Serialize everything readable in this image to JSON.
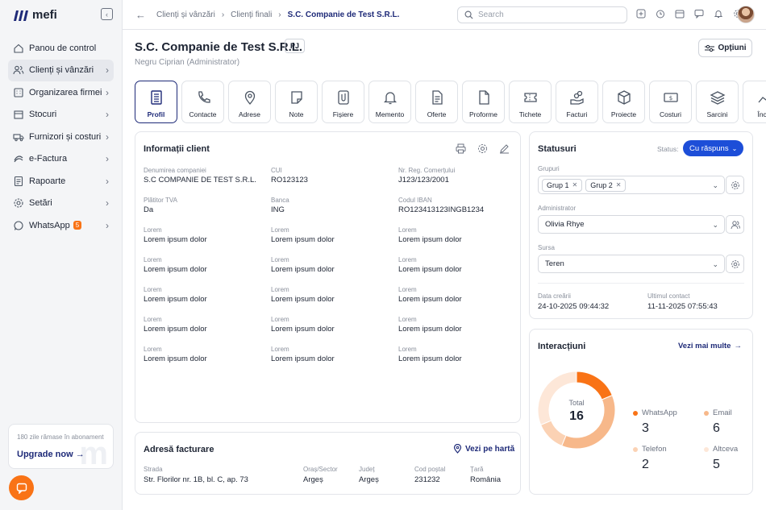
{
  "app": {
    "name": "mefi"
  },
  "sidebar": {
    "items": [
      {
        "label": "Panou de control",
        "icon": "home-icon"
      },
      {
        "label": "Clienți și vânzări",
        "icon": "users-icon",
        "active": true
      },
      {
        "label": "Organizarea firmei",
        "icon": "org-icon"
      },
      {
        "label": "Stocuri",
        "icon": "box-icon"
      },
      {
        "label": "Furnizori și costuri",
        "icon": "truck-icon"
      },
      {
        "label": "e-Factura",
        "icon": "efactura-icon"
      },
      {
        "label": "Rapoarte",
        "icon": "report-icon"
      },
      {
        "label": "Setări",
        "icon": "gear-icon"
      },
      {
        "label": "WhatsApp",
        "icon": "whatsapp-icon",
        "badge": "5"
      }
    ],
    "upgrade": {
      "subtitle": "180 zile rămase în abonament",
      "link": "Upgrade now"
    }
  },
  "topbar": {
    "breadcrumbs": [
      "Clienți și vânzări",
      "Clienți finali",
      "S.C. Companie de Test S.R.L."
    ],
    "search_placeholder": "Search"
  },
  "header": {
    "title": "S.C. Companie de Test S.R.L.",
    "type_badge": "PJ",
    "subtitle": "Negru Ciprian (Administrator)",
    "options_label": "Opțiuni"
  },
  "tabs": [
    "Profil",
    "Contacte",
    "Adrese",
    "Note",
    "Fișiere",
    "Memento",
    "Oferte",
    "Proforme",
    "Tichete",
    "Facturi",
    "Proiecte",
    "Costuri",
    "Sarcini",
    "Înca"
  ],
  "client_info": {
    "title": "Informații client",
    "rows": [
      [
        {
          "label": "Denumirea companiei",
          "value": "S.C COMPANIE DE TEST S.R.L."
        },
        {
          "label": "CUI",
          "value": "RO123123"
        },
        {
          "label": "Nr. Reg. Comerțului",
          "value": "J123/123/2001"
        }
      ],
      [
        {
          "label": "Plătitor TVA",
          "value": "Da"
        },
        {
          "label": "Banca",
          "value": "ING"
        },
        {
          "label": "Codul IBAN",
          "value": "RO123413123INGB1234"
        }
      ],
      [
        {
          "label": "Lorem",
          "value": "Lorem ipsum dolor"
        },
        {
          "label": "Lorem",
          "value": "Lorem ipsum dolor"
        },
        {
          "label": "Lorem",
          "value": "Lorem ipsum dolor"
        }
      ],
      [
        {
          "label": "Lorem",
          "value": "Lorem ipsum dolor"
        },
        {
          "label": "Lorem",
          "value": "Lorem ipsum dolor"
        },
        {
          "label": "Lorem",
          "value": "Lorem ipsum dolor"
        }
      ],
      [
        {
          "label": "Lorem",
          "value": "Lorem ipsum dolor"
        },
        {
          "label": "Lorem",
          "value": "Lorem ipsum dolor"
        },
        {
          "label": "Lorem",
          "value": "Lorem ipsum dolor"
        }
      ],
      [
        {
          "label": "Lorem",
          "value": "Lorem ipsum dolor"
        },
        {
          "label": "Lorem",
          "value": "Lorem ipsum dolor"
        },
        {
          "label": "Lorem",
          "value": "Lorem ipsum dolor"
        }
      ],
      [
        {
          "label": "Lorem",
          "value": "Lorem ipsum dolor"
        },
        {
          "label": "Lorem",
          "value": "Lorem ipsum dolor"
        },
        {
          "label": "Lorem",
          "value": "Lorem ipsum dolor"
        }
      ]
    ]
  },
  "billing": {
    "title": "Adresă facturare",
    "map_link": "Vezi pe hartă",
    "fields": [
      {
        "label": "Strada",
        "value": "Str. Florilor nr. 1B, bl. C, ap. 73"
      },
      {
        "label": "Oraș/Sector",
        "value": "Argeș"
      },
      {
        "label": "Județ",
        "value": "Argeș"
      },
      {
        "label": "Cod poștal",
        "value": "231232"
      },
      {
        "label": "Țară",
        "value": "România"
      }
    ]
  },
  "statuses": {
    "title": "Statusuri",
    "status_label": "Status:",
    "status_value": "Cu răspuns",
    "groups_label": "Grupuri",
    "groups": [
      "Grup 1",
      "Grup 2"
    ],
    "admin_label": "Administrator",
    "admin_value": "Olivia Rhye",
    "source_label": "Sursa",
    "source_value": "Teren",
    "created_label": "Data creării",
    "created_value": "24-10-2025 09:44:32",
    "last_contact_label": "Ultimul contact",
    "last_contact_value": "11-11-2025 07:55:43"
  },
  "interactions": {
    "title": "Interacțiuni",
    "more_link": "Vezi mai multe",
    "total_label": "Total",
    "total_value": "16",
    "items": [
      {
        "label": "WhatsApp",
        "value": "3",
        "color": "#f97316"
      },
      {
        "label": "Email",
        "value": "6",
        "color": "#f7b88a"
      },
      {
        "label": "Telefon",
        "value": "2",
        "color": "#fbd2b4"
      },
      {
        "label": "Altceva",
        "value": "5",
        "color": "#fde7d8"
      }
    ]
  }
}
